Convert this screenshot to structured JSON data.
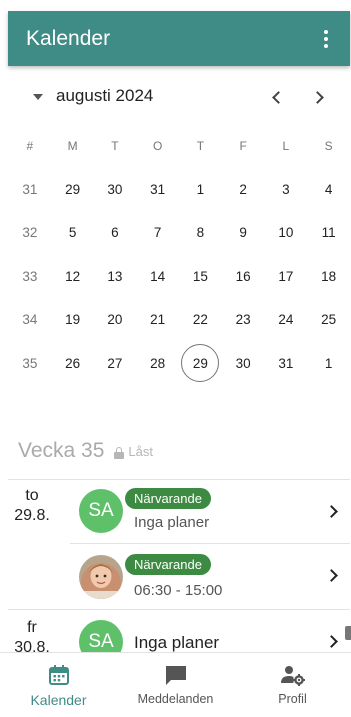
{
  "appbar": {
    "title": "Kalender",
    "menu_icon": "more-vert-icon"
  },
  "calendar": {
    "month_label": "augusti 2024",
    "weekday_header": [
      "#",
      "M",
      "T",
      "O",
      "T",
      "F",
      "L",
      "S"
    ],
    "weeks": [
      {
        "week": "31",
        "days": [
          "29",
          "30",
          "31",
          "1",
          "2",
          "3",
          "4"
        ]
      },
      {
        "week": "32",
        "days": [
          "5",
          "6",
          "7",
          "8",
          "9",
          "10",
          "11"
        ]
      },
      {
        "week": "33",
        "days": [
          "12",
          "13",
          "14",
          "15",
          "16",
          "17",
          "18"
        ]
      },
      {
        "week": "34",
        "days": [
          "19",
          "20",
          "21",
          "22",
          "23",
          "24",
          "25"
        ]
      },
      {
        "week": "35",
        "days": [
          "26",
          "27",
          "28",
          "29",
          "30",
          "31",
          "1"
        ]
      }
    ],
    "today": "29"
  },
  "week_section": {
    "title": "Vecka 35",
    "lock_label": "Låst",
    "days": [
      {
        "weekday": "to",
        "date": "29.8.",
        "entries": [
          {
            "avatar_initials": "SA",
            "badge": "Närvarande",
            "detail": "Inga planer"
          },
          {
            "avatar": "child-photo",
            "badge": "Närvarande",
            "detail": "06:30 - 15:00"
          }
        ]
      },
      {
        "weekday": "fr",
        "date": "30.8.",
        "entries": [
          {
            "avatar_initials": "SA",
            "detail": "Inga planer"
          }
        ]
      }
    ]
  },
  "bottom_nav": [
    {
      "label": "Kalender",
      "icon": "calendar-icon",
      "active": true
    },
    {
      "label": "Meddelanden",
      "icon": "chat-bubble-icon",
      "active": false
    },
    {
      "label": "Profil",
      "icon": "profile-settings-icon",
      "active": false
    }
  ],
  "colors": {
    "primary": "#3f8b86",
    "avatar_green": "#5fc06a",
    "badge_green": "#3d8b43"
  }
}
